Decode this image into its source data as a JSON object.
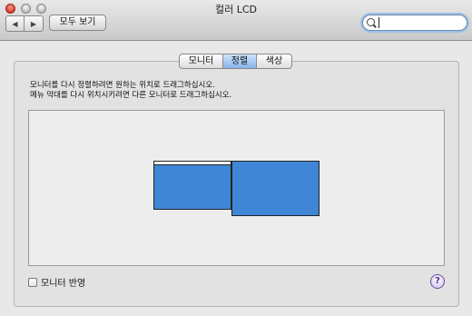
{
  "window": {
    "title": "컬러 LCD"
  },
  "toolbar": {
    "back_icon": "◀",
    "forward_icon": "▶",
    "show_all_label": "모두 보기",
    "search_value": ""
  },
  "tabs": [
    {
      "label": "모니터",
      "selected": false
    },
    {
      "label": "정렬",
      "selected": true
    },
    {
      "label": "색상",
      "selected": false
    }
  ],
  "arrangement": {
    "instruction_line1": "모니터를 다시 정렬하려면 원하는 위치로 드래그하십시오.",
    "instruction_line2": "메뉴 막대를 다시 위치시키려면 다른 모니터로 드래그하십시오.",
    "display_color": "#3f86d6"
  },
  "mirror": {
    "label": "모니터 반영",
    "checked": false
  },
  "help": {
    "label": "?"
  }
}
